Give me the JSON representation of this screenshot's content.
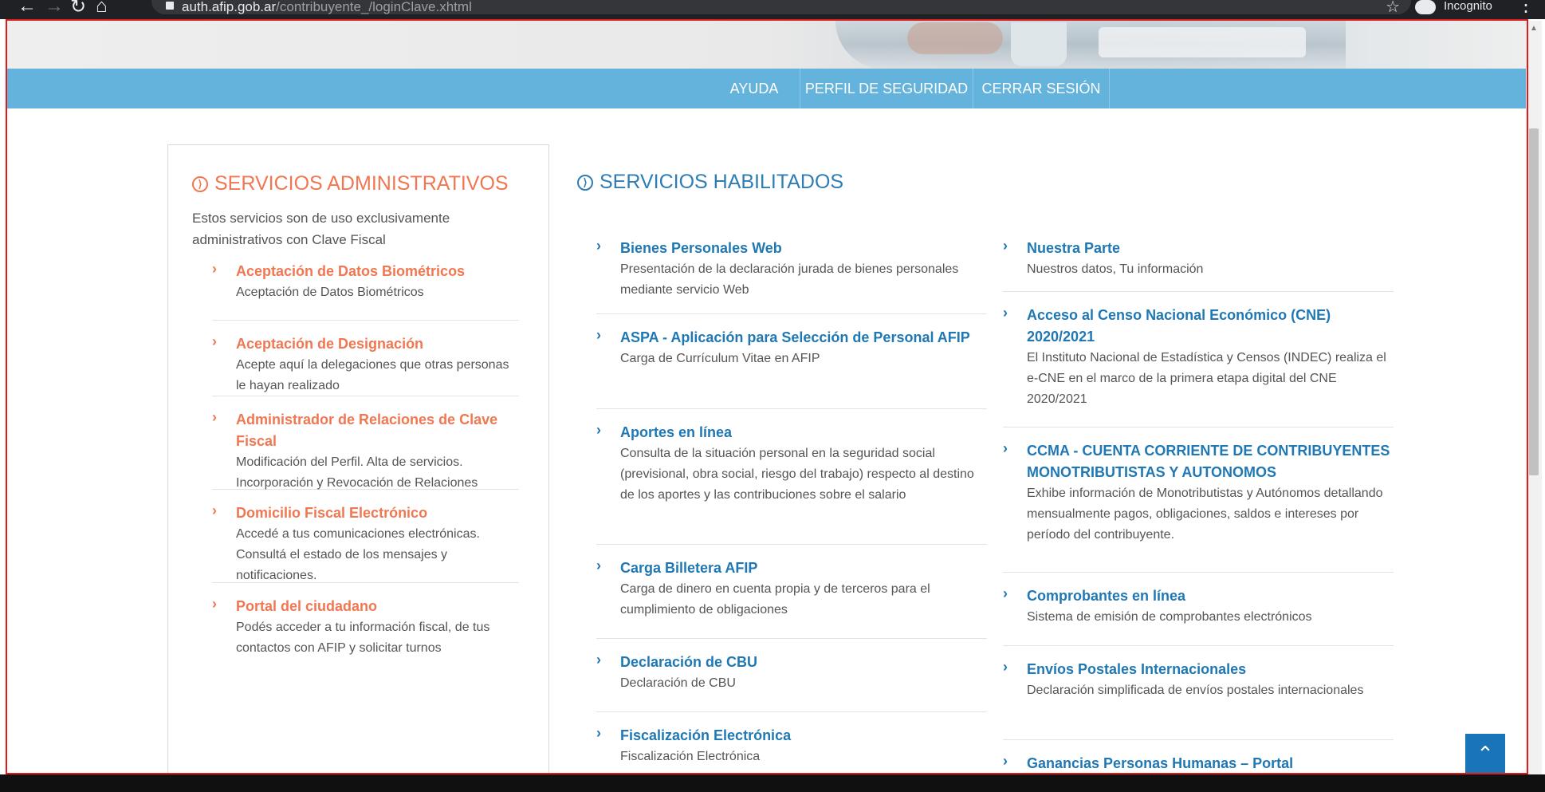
{
  "browser": {
    "url_domain": "auth.afip.gob.ar",
    "url_path": "/contribuyente_/loginClave.xhtml",
    "incognito_label": "Incognito"
  },
  "nav": {
    "items": [
      "AYUDA",
      "PERFIL DE SEGURIDAD",
      "CERRAR SESIÓN"
    ]
  },
  "admin": {
    "title": "SERVICIOS ADMINISTRATIVOS",
    "intro": "Estos servicios son de uso exclusivamente administrativos con Clave Fiscal",
    "services": [
      {
        "name": "Aceptación de Datos Biométricos",
        "desc": "Aceptación de Datos Biométricos"
      },
      {
        "name": "Aceptación de Designación",
        "desc": "Acepte aquí la delegaciones que otras personas le hayan realizado"
      },
      {
        "name": "Administrador de Relaciones de Clave Fiscal",
        "desc": "Modificación del Perfil. Alta de servicios. Incorporación y Revocación de Relaciones"
      },
      {
        "name": "Domicilio Fiscal Electrónico",
        "desc": "Accedé a tus comunicaciones electrónicas. Consultá el estado de los mensajes y notificaciones."
      },
      {
        "name": "Portal del ciudadano",
        "desc": "Podés acceder a tu información fiscal, de tus contactos con AFIP y solicitar turnos"
      }
    ]
  },
  "habilitados": {
    "title": "SERVICIOS HABILITADOS",
    "col1": [
      {
        "name": "Bienes Personales Web",
        "desc": "Presentación de la declaración jurada de bienes personales mediante servicio Web"
      },
      {
        "name": "ASPA - Aplicación para Selección de Personal AFIP",
        "desc": "Carga de Currículum Vitae en AFIP"
      },
      {
        "name": "Aportes en línea",
        "desc": "Consulta de la situación personal en la seguridad social (previsional, obra social, riesgo del trabajo) respecto al destino de los aportes y las contribuciones sobre el salario"
      },
      {
        "name": "Carga Billetera AFIP",
        "desc": "Carga de dinero en cuenta propia y de terceros para el cumplimiento de obligaciones"
      },
      {
        "name": "Declaración de CBU",
        "desc": "Declaración de CBU"
      },
      {
        "name": "Fiscalización Electrónica",
        "desc": "Fiscalización Electrónica"
      }
    ],
    "col2": [
      {
        "name": "Nuestra Parte",
        "desc": "Nuestros datos, Tu información"
      },
      {
        "name": "Acceso al Censo Nacional Económico (CNE) 2020/2021",
        "desc": "El Instituto Nacional de Estadística y Censos (INDEC) realiza el e-CNE en el marco de la primera etapa digital del CNE 2020/2021"
      },
      {
        "name": "CCMA - CUENTA CORRIENTE DE CONTRIBUYENTES MONOTRIBUTISTAS Y AUTONOMOS",
        "desc": "Exhibe información de Monotributistas y Autónomos detallando mensualmente pagos, obligaciones, saldos e intereses por período del contribuyente."
      },
      {
        "name": "Comprobantes en línea",
        "desc": "Sistema de emisión de comprobantes electrónicos"
      },
      {
        "name": "Envíos Postales Internacionales",
        "desc": "Declaración simplificada de envíos postales internacionales"
      },
      {
        "name": "Ganancias Personas Humanas – Portal",
        "desc": ""
      }
    ]
  },
  "icons": {
    "circle_chevron": "⟩",
    "item_chevron": "›",
    "back_to_top": "⌃"
  },
  "colors": {
    "nav_bar": "#63b3dc",
    "admin_accent": "#f07751",
    "link_blue": "#1f78b4",
    "back_to_top": "#1a74b8"
  }
}
